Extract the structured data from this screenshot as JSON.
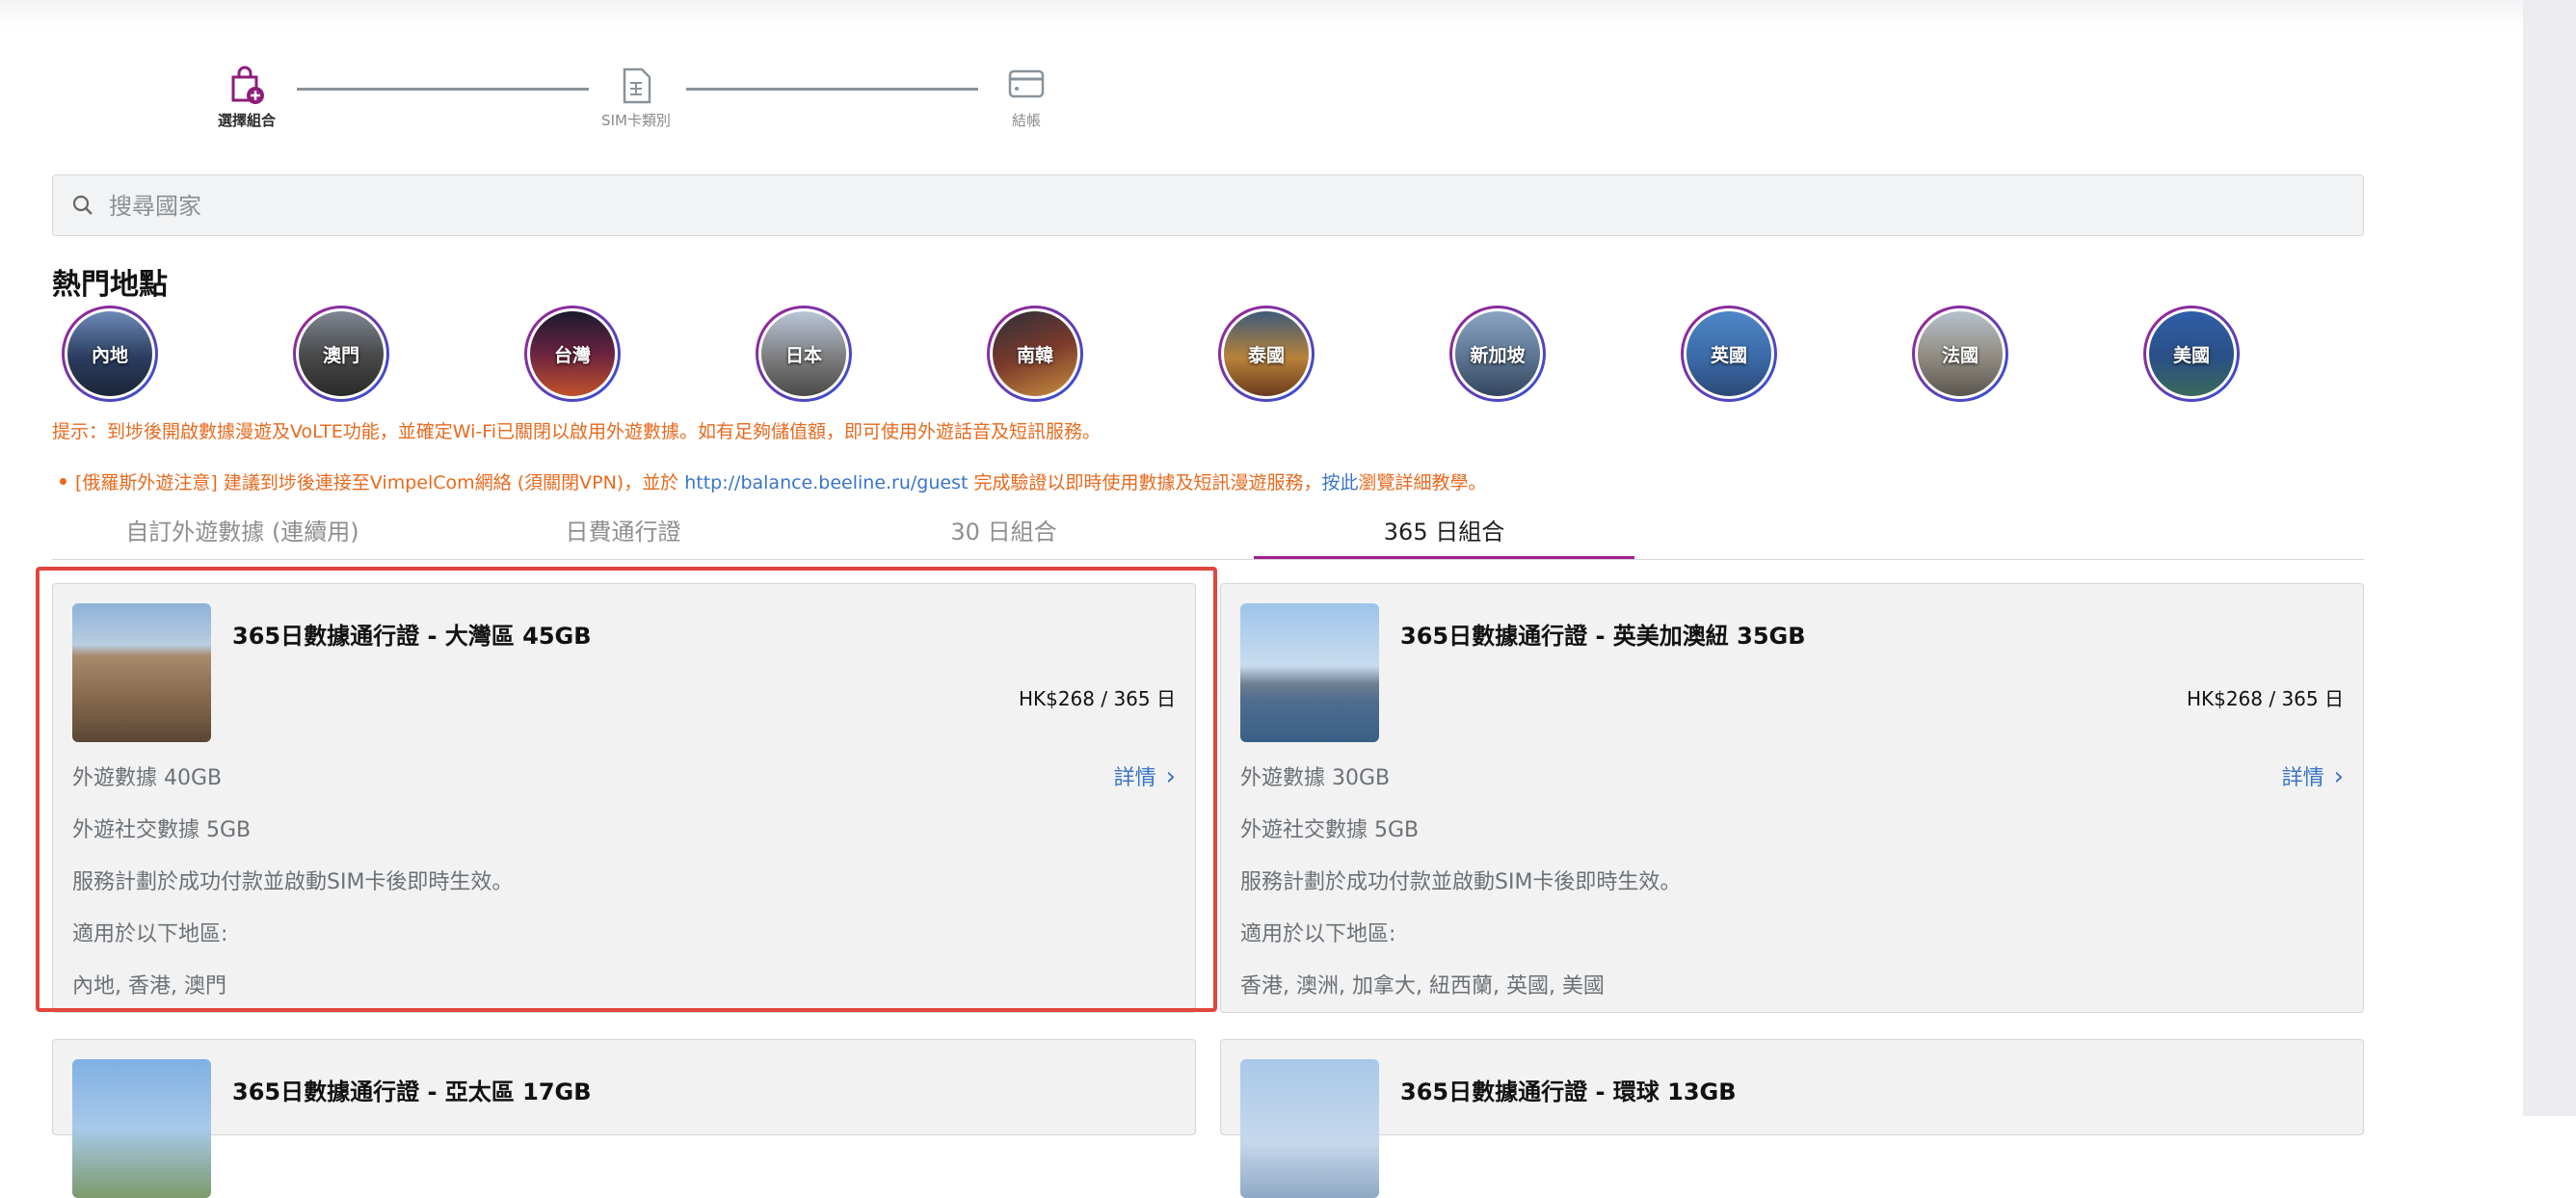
{
  "stepper": {
    "steps": [
      {
        "label": "選擇組合",
        "icon": "bag-add-icon",
        "active": true
      },
      {
        "label": "SIM卡類別",
        "icon": "sim-card-icon",
        "active": false
      },
      {
        "label": "結帳",
        "icon": "credit-card-icon",
        "active": false
      }
    ]
  },
  "search": {
    "placeholder": "搜尋國家",
    "icon": "search-icon"
  },
  "popular": {
    "title": "熱門地點",
    "items": [
      {
        "label": "內地"
      },
      {
        "label": "澳門"
      },
      {
        "label": "台灣"
      },
      {
        "label": "日本"
      },
      {
        "label": "南韓"
      },
      {
        "label": "泰國"
      },
      {
        "label": "新加坡"
      },
      {
        "label": "英國"
      },
      {
        "label": "法國"
      },
      {
        "label": "美國"
      }
    ]
  },
  "notices": {
    "tip": "提示：到埗後開啟數據漫遊及VoLTE功能，並確定Wi-Fi已關閉以啟用外遊數據。如有足夠儲值額，即可使用外遊話音及短訊服務。",
    "russia_prefix": "[俄羅斯外遊注意] 建議到埗後連接至VimpelCom網絡 (須關閉VPN)，並於 ",
    "russia_link": "http://balance.beeline.ru/guest",
    "russia_middle": " 完成驗證以即時使用數據及短訊漫遊服務，",
    "russia_link2": "按此",
    "russia_suffix": "瀏覽詳細教學。"
  },
  "tabs": [
    {
      "label": "自訂外遊數據 (連續用)",
      "active": false
    },
    {
      "label": "日費通行證",
      "active": false
    },
    {
      "label": "30 日組合",
      "active": false
    },
    {
      "label": "365 日組合",
      "active": true
    }
  ],
  "plans": [
    {
      "title": "365日數據通行證 - 大灣區 45GB",
      "price": "HK$268 / 365 日",
      "details": "詳情",
      "data": "外遊數據 40GB",
      "social": "外遊社交數據 5GB",
      "activation": "服務計劃於成功付款並啟動SIM卡後即時生效。",
      "regions_label": "適用於以下地區:",
      "regions": "內地, 香港, 澳門"
    },
    {
      "title": "365日數據通行證 - 英美加澳紐 35GB",
      "price": "HK$268 / 365 日",
      "details": "詳情",
      "data": "外遊數據 30GB",
      "social": "外遊社交數據 5GB",
      "activation": "服務計劃於成功付款並啟動SIM卡後即時生效。",
      "regions_label": "適用於以下地區:",
      "regions": "香港, 澳洲, 加拿大, 紐西蘭, 英國, 美國"
    },
    {
      "title": "365日數據通行證 - 亞太區 17GB"
    },
    {
      "title": "365日數據通行證 - 環球 13GB"
    }
  ],
  "colors": {
    "accent": "#a51e8c",
    "notice": "#e86a1e",
    "link": "#3a74c7",
    "highlight_border": "#e0463c"
  }
}
